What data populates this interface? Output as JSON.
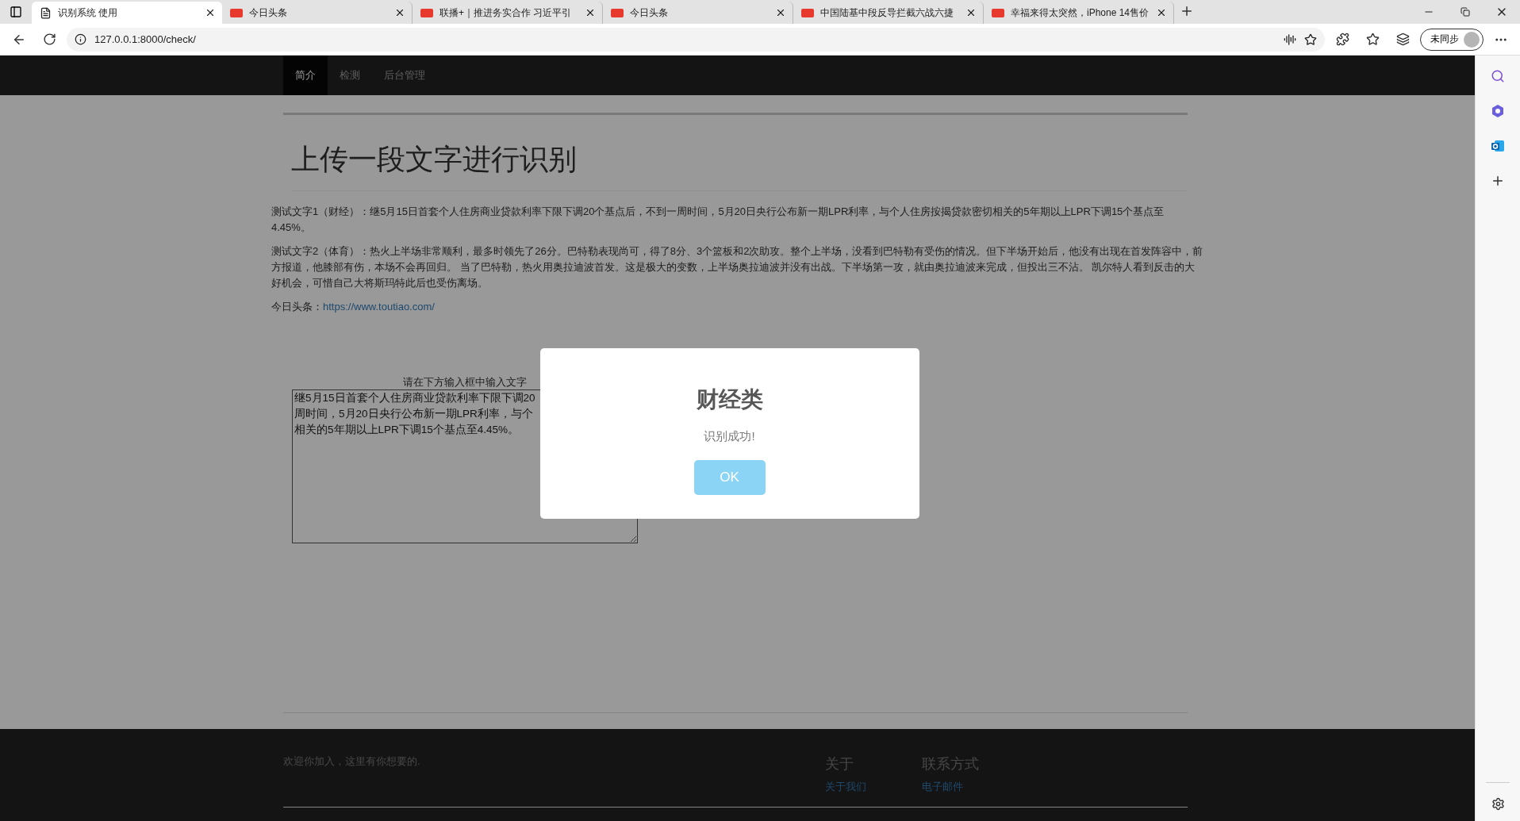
{
  "browser": {
    "tabs": [
      {
        "title": "识别系统 使用",
        "selected": true,
        "kind": "page"
      },
      {
        "title": "今日头条",
        "selected": false,
        "kind": "news"
      },
      {
        "title": "联播+｜推进务实合作 习近平引",
        "selected": false,
        "kind": "news"
      },
      {
        "title": "今日头条",
        "selected": false,
        "kind": "news"
      },
      {
        "title": "中国陆基中段反导拦截六战六捷",
        "selected": false,
        "kind": "news"
      },
      {
        "title": "幸福来得太突然，iPhone 14售价",
        "selected": false,
        "kind": "news"
      }
    ],
    "address": "127.0.0.1:8000/check/",
    "profile": "未同步"
  },
  "nav": {
    "items": [
      {
        "label": "简介",
        "selected": true
      },
      {
        "label": "检测",
        "selected": false
      },
      {
        "label": "后台管理",
        "selected": false
      }
    ]
  },
  "heading": "上传一段文字进行识别",
  "paragraphs": [
    "测试文字1（财经）：继5月15日首套个人住房商业贷款利率下限下调20个基点后，不到一周时间，5月20日央行公布新一期LPR利率，与个人住房按揭贷款密切相关的5年期以上LPR下调15个基点至4.45%。",
    "测试文字2（体育）：热火上半场非常顺利，最多时领先了26分。巴特勒表现尚可，得了8分、3个篮板和2次助攻。整个上半场，没看到巴特勒有受伤的情况。但下半场开始后，他没有出现在首发阵容中，前方报道，他膝部有伤，本场不会再回归。 当了巴特勒，热火用奥拉迪波首发。这是极大的变数，上半场奥拉迪波并没有出战。下半场第一攻，就由奥拉迪波来完成，但投出三不沾。 凯尔特人看到反击的大好机会，可惜自己大将斯玛特此后也受伤离场。"
  ],
  "link_line": {
    "label": "今日头条：",
    "url": "https://www.toutiao.com/"
  },
  "input": {
    "label": "请在下方输入框中输入文字",
    "lines": [
      "继5月15日首套个人住房商业贷款利率下限下调20",
      "周时间，5月20日央行公布新一期LPR利率，与个",
      "相关的5年期以上LPR下调15个基点至4.45%。"
    ]
  },
  "footer": {
    "tagline": "欢迎你加入，这里有你想要的.",
    "columns": [
      {
        "title": "关于",
        "link": "关于我们"
      },
      {
        "title": "联系方式",
        "link": "电子邮件"
      }
    ]
  },
  "dialog": {
    "title": "财经类",
    "message": "识别成功!",
    "button": "OK"
  }
}
